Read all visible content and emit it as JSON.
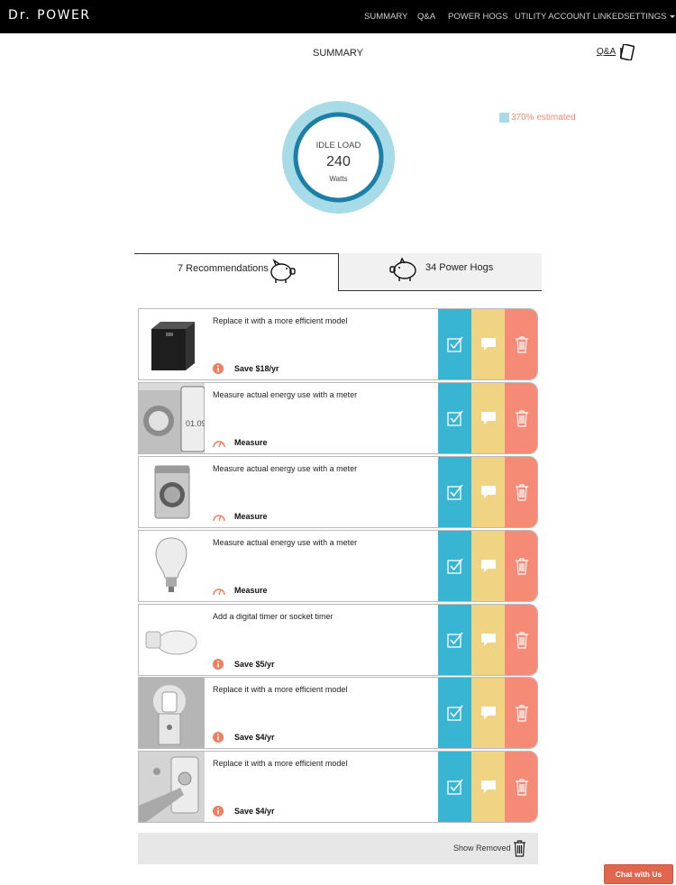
{
  "nav": {
    "brand_prefix": "Dr.",
    "brand_suffix": "POWER",
    "items": [
      "SUMMARY",
      "Q&A",
      "POWER HOGS",
      "UTILITY ACCOUNT LINKED",
      "SETTINGS"
    ]
  },
  "page": {
    "title": "SUMMARY",
    "qa_link": "Q&A"
  },
  "idle_load": {
    "title": "IDLE LOAD",
    "value": "240",
    "unit": "Watts",
    "legend": "370% estimated",
    "legend_color": "#a6dbe7",
    "ring_color": "#1b7fa8"
  },
  "tabs": {
    "recommendations": "7 Recommendations",
    "power_hogs": "34 Power Hogs"
  },
  "recommendations": [
    {
      "text": "Replace it with a more efficient model",
      "action": "Save $18/yr",
      "badge": "info-icon",
      "thumb": "ups-device"
    },
    {
      "text": "Measure actual energy use with a meter",
      "action": "Measure",
      "badge": "meter-icon",
      "thumb": "washer-and-phone"
    },
    {
      "text": "Measure actual energy use with a meter",
      "action": "Measure",
      "badge": "meter-icon",
      "thumb": "washing-machine"
    },
    {
      "text": "Measure actual energy use with a meter",
      "action": "Measure",
      "badge": "meter-icon",
      "thumb": "light-bulb"
    },
    {
      "text": "Add a digital timer or socket timer",
      "action": "Save $5/yr",
      "badge": "info-icon",
      "thumb": "toilet-seat"
    },
    {
      "text": "Replace it with a more efficient model",
      "action": "Save $4/yr",
      "badge": "info-icon",
      "thumb": "night-light"
    },
    {
      "text": "Replace it with a more efficient model",
      "action": "Save $4/yr",
      "badge": "info-icon",
      "thumb": "doorbell"
    }
  ],
  "action_colors": {
    "done": "#39b5d4",
    "note": "#f0d383",
    "delete": "#f58a76"
  },
  "footer": {
    "show_removed": "Show Removed",
    "chat": "Chat with Us"
  }
}
